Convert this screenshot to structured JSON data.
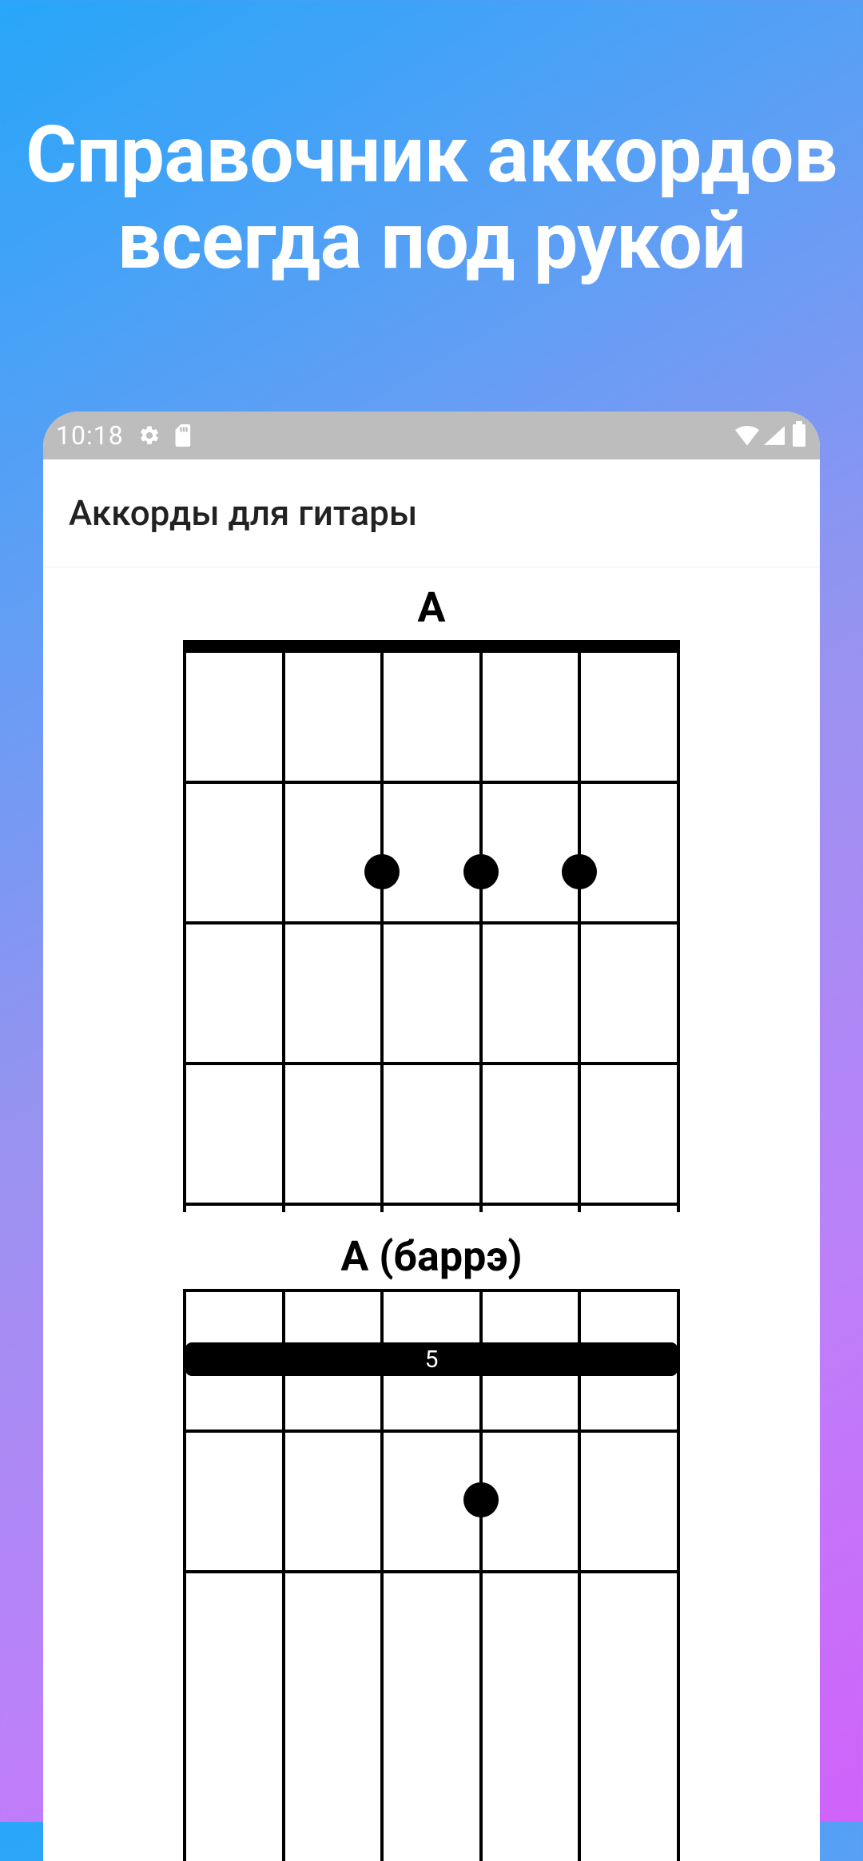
{
  "promo_title": "Справочник аккордов всегда под рукой",
  "status_bar": {
    "time": "10:18"
  },
  "app_bar": {
    "title": "Аккорды для гитары"
  },
  "chords": [
    {
      "name": "A"
    },
    {
      "name": "A (баррэ)",
      "barre_label": "5"
    }
  ]
}
